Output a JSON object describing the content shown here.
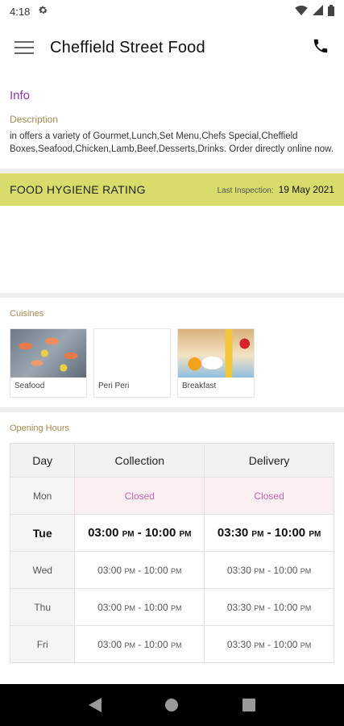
{
  "status": {
    "time": "4:18"
  },
  "app": {
    "title": "Cheffield Street Food"
  },
  "info": {
    "heading": "Info",
    "description_label": "Description",
    "description": "in  offers a variety of Gourmet,Lunch,Set Menu,Chefs Special,Cheffield Boxes,Seafood,Chicken,Lamb,Beef,Desserts,Drinks. Order directly online now."
  },
  "hygiene": {
    "title": "FOOD HYGIENE RATING",
    "last_inspection_label": "Last Inspection:",
    "last_inspection_date": "19 May 2021"
  },
  "cuisines": {
    "label": "Cuisines",
    "items": [
      {
        "name": "Seafood"
      },
      {
        "name": "Peri Peri"
      },
      {
        "name": "Breakfast"
      }
    ]
  },
  "hours": {
    "label": "Opening Hours",
    "headers": {
      "day": "Day",
      "collection": "Collection",
      "delivery": "Delivery"
    },
    "rows": [
      {
        "day": "Mon",
        "collection": "Closed",
        "delivery": "Closed"
      },
      {
        "day": "Tue",
        "c_from": "03:00",
        "c_to": "10:00",
        "d_from": "03:30",
        "d_to": "10:00"
      },
      {
        "day": "Wed",
        "c_from": "03:00",
        "c_to": "10:00",
        "d_from": "03:30",
        "d_to": "10:00"
      },
      {
        "day": "Thu",
        "c_from": "03:00",
        "c_to": "10:00",
        "d_from": "03:30",
        "d_to": "10:00"
      },
      {
        "day": "Fri",
        "c_from": "03:00",
        "c_to": "10:00",
        "d_from": "03:30",
        "d_to": "10:00"
      }
    ],
    "pm": "PM"
  },
  "colors": {
    "accent_purple": "#8e3aa6",
    "label_gold": "#a08a53",
    "hygiene_bar": "#d7dc6b",
    "closed_bg": "#fceff1",
    "closed_text": "#c064b4"
  },
  "icons": {
    "status": [
      "settings-gear-icon",
      "wifi-icon",
      "signal-icon",
      "battery-icon"
    ],
    "app_bar": [
      "hamburger-menu-icon",
      "phone-icon"
    ],
    "nav": [
      "back-icon",
      "home-icon",
      "recents-icon"
    ]
  }
}
